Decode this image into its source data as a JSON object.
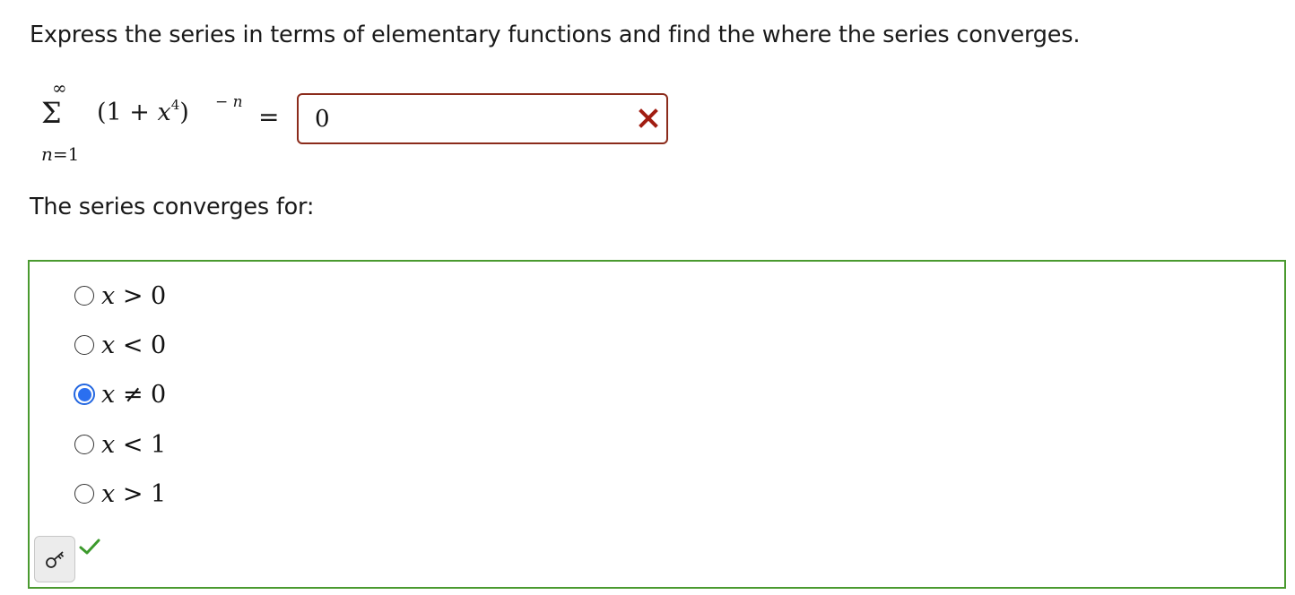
{
  "question": {
    "text": "Express the series in terms of elementary functions and find the where the series converges."
  },
  "series": {
    "upper_limit": "∞",
    "sigma": "Σ",
    "lower_index": "n",
    "lower_eq": "=1",
    "term_open": "(1 + ",
    "term_var": "x",
    "term_power": "4",
    "term_close": ")",
    "exp_sign": "− ",
    "exp_var": "n",
    "equals": "="
  },
  "answer": {
    "value": "0",
    "status_icon": "x-icon",
    "status_color": "#a11d12",
    "border_color": "#8b2b1b"
  },
  "convergence": {
    "prompt": "The series converges for:",
    "panel_border_color": "#4a9a2f",
    "options": [
      {
        "var": "x",
        "rel": " > 0",
        "selected": false
      },
      {
        "var": "x",
        "rel": " < 0",
        "selected": false
      },
      {
        "var": "x",
        "rel": " ≠ 0",
        "selected": true
      },
      {
        "var": "x",
        "rel": " < 1",
        "selected": false
      },
      {
        "var": "x",
        "rel": " > 1",
        "selected": false
      }
    ]
  },
  "feedback": {
    "key_icon": "key-icon",
    "check_icon": "checkmark-icon",
    "check_color": "#3c9a2c"
  },
  "colors": {
    "radio_selected": "#2a6ff0"
  }
}
